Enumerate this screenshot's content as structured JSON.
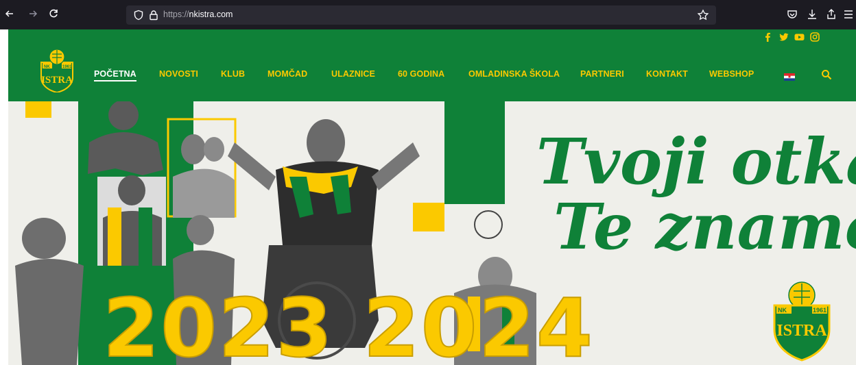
{
  "browser": {
    "url_protocol": "https://",
    "url_domain": "nkistra.com",
    "icons": [
      "back-arrow-icon",
      "forward-arrow-icon",
      "reload-icon",
      "shield-icon",
      "lock-icon",
      "bookmark-star-icon",
      "pocket-icon",
      "download-icon",
      "share-icon",
      "menu-icon"
    ]
  },
  "header": {
    "social": [
      "facebook-icon",
      "twitter-icon",
      "youtube-icon",
      "instagram-icon"
    ],
    "logo": {
      "top": "NK",
      "year": "1961",
      "name": "ISTRA"
    },
    "nav": [
      "POČETNA",
      "NOVOSTI",
      "KLUB",
      "MOMČAD",
      "ULAZNICE",
      "60 GODINA",
      "OMLADINSKA ŠKOLA",
      "PARTNERI",
      "KONTAKT",
      "WEBSHOP"
    ],
    "active_nav": "POČETNA"
  },
  "hero": {
    "slogan_line1": "Tvoji otkad",
    "slogan_line2": "Te znamo!",
    "season": "2023 2024",
    "logo": {
      "top": "NK",
      "year": "1961",
      "name": "ISTRA"
    }
  },
  "colors": {
    "brand_green": "#0f8138",
    "brand_yellow": "#fbc900",
    "hero_bg": "#efefea",
    "browser_bg": "#1c1b22"
  }
}
